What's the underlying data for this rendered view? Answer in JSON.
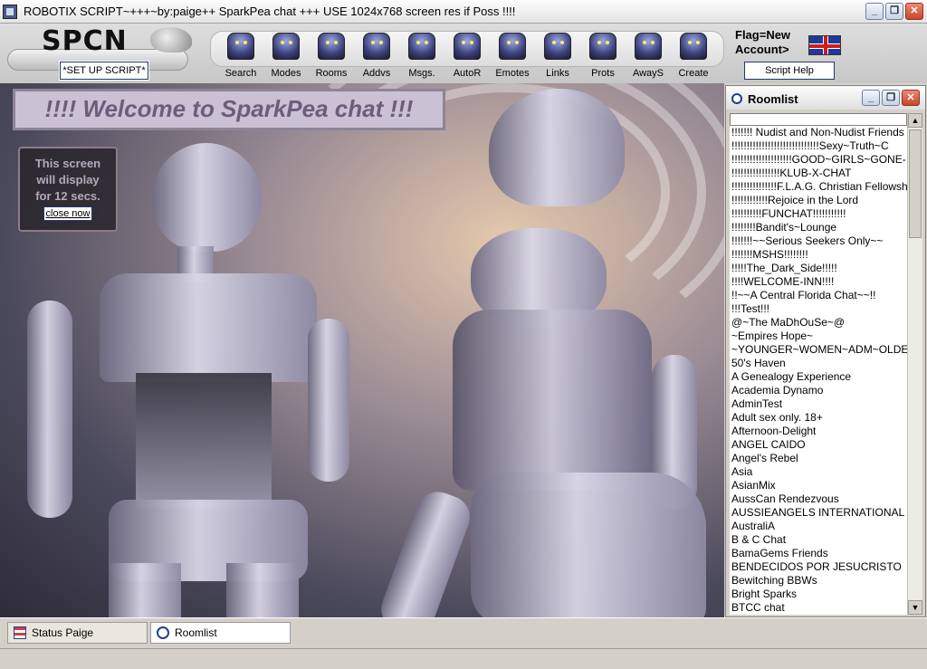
{
  "window": {
    "title": "ROBOTIX SCRIPT~+++~by:paige++ SparkPea chat +++ USE 1024x768 screen res if Poss !!!!",
    "min_label": "_",
    "max_label": "❐",
    "close_label": "✕"
  },
  "header": {
    "logo_text": "SPCN",
    "setup_label": "*SET UP SCRIPT*",
    "flag_line1": "Flag=New",
    "flag_line2": "Account>",
    "help_label": "Script Help"
  },
  "toolbar": {
    "tools": [
      {
        "label": "Search",
        "icon": "robot-search-icon"
      },
      {
        "label": "Modes",
        "icon": "robot-modes-icon"
      },
      {
        "label": "Rooms",
        "icon": "robot-rooms-icon"
      },
      {
        "label": "Addvs",
        "icon": "robot-addvs-icon"
      },
      {
        "label": "Msgs.",
        "icon": "robot-msgs-icon"
      },
      {
        "label": "AutoR",
        "icon": "robot-autor-icon"
      },
      {
        "label": "Emotes",
        "icon": "robot-emotes-icon"
      },
      {
        "label": "Links",
        "icon": "robot-links-icon"
      },
      {
        "label": "Prots",
        "icon": "robot-prots-icon"
      },
      {
        "label": "AwayS",
        "icon": "robot-aways-icon"
      },
      {
        "label": "Create",
        "icon": "robot-create-icon"
      }
    ]
  },
  "welcome": {
    "banner": "!!!! Welcome to SparkPea chat !!!",
    "notice_line1": "This screen",
    "notice_line2": "will display",
    "notice_line3": "for 12 secs.",
    "close_label": "close now"
  },
  "roomlist": {
    "title": "Roomlist",
    "rooms": [
      "!!!!!!! Nudist and Non-Nudist Friends",
      "!!!!!!!!!!!!!!!!!!!!!!!!!!!!!Sexy~Truth~C",
      "!!!!!!!!!!!!!!!!!!!!GOOD~GIRLS~GONE-",
      "!!!!!!!!!!!!!!!!KLUB-X-CHAT",
      "!!!!!!!!!!!!!!!F.L.A.G. Christian Fellowsh",
      "!!!!!!!!!!!!Rejoice in the Lord",
      "!!!!!!!!!!FUNCHAT!!!!!!!!!!!",
      "!!!!!!!!Bandit's~Lounge",
      "!!!!!!!~~Serious Seekers Only~~",
      "!!!!!!!MSHS!!!!!!!!",
      "!!!!!The_Dark_Side!!!!!",
      "!!!!WELCOME-INN!!!!",
      "!!~~A Central Florida Chat~~!!",
      "!!!Test!!!",
      "@~The MaDhOuSe~@",
      "~Empires Hope~",
      "~YOUNGER~WOMEN~ADM~OLDER",
      "50's Haven",
      "A Genealogy Experience",
      "Academia Dynamo",
      "AdminTest",
      "Adult sex only. 18+",
      "Afternoon-Delight",
      "ANGEL CAIDO",
      "Angel's Rebel",
      "Asia",
      "AsianMix",
      "AussCan Rendezvous",
      "AUSSIEANGELS INTERNATIONAL CI",
      "AustraliA",
      "B & C Chat",
      "BamaGems Friends",
      "BENDECIDOS POR JESUCRISTO",
      "Bewitching BBWs",
      "Bright Sparks",
      "BTCC chat"
    ]
  },
  "taskbar": {
    "status_label": "Status Paige",
    "roomlist_label": "Roomlist"
  }
}
